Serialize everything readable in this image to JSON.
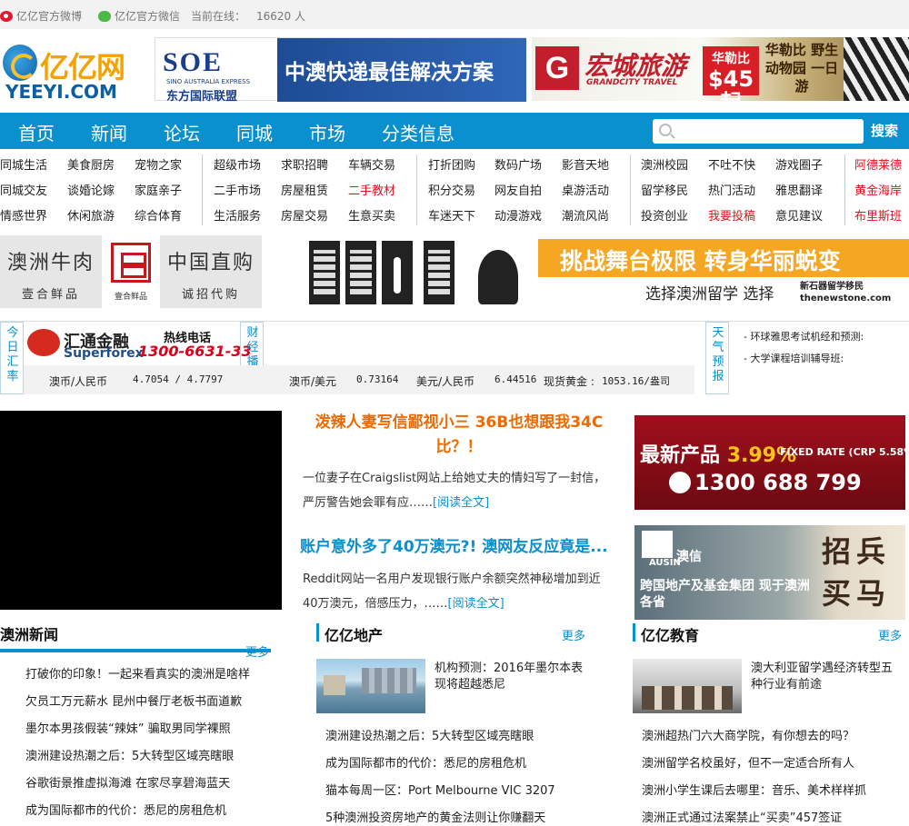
{
  "topbar": {
    "weibo": "亿亿官方微博",
    "wechat": "亿亿官方微信",
    "online_label": "当前在线：",
    "online_count": "16620 人"
  },
  "logo": {
    "cn": "亿亿网",
    "en": "YEEYI.COM"
  },
  "ads": {
    "soe": {
      "logo": "SOE",
      "sub": "SINO AUSTRALIA EXPRESS",
      "cn": "东方国际联盟",
      "slogan": "中澳快递最佳解决方案"
    },
    "grand": {
      "logo": "G",
      "cn": "宏城旅游",
      "en": "GRANDCITY TRAVEL",
      "price_top": "华勒比",
      "price": "$45起",
      "zoo": "华勒比 野生动物园 一日游"
    },
    "beef1": {
      "title": "澳洲牛肉",
      "sub": "壹合鲜品"
    },
    "beef_logo": "壹合鲜品",
    "beef2": {
      "title": "中国直购",
      "sub": "诚招代购"
    },
    "stage": {
      "headline": "挑战舞台极限 转身华丽蜕变",
      "choose": "选择澳洲留学 选择",
      "stone": "新石器留学移民 thenewstone.com"
    },
    "right1": {
      "line1": "最新产品",
      "rate": "3.99%",
      "fixed": "FIXED RATE (CRP 5.58%)",
      "phone": "1300 688 799"
    },
    "right2": {
      "brand": "AUSIN",
      "brand_cn": "澳信",
      "line": "跨国地产及基金集团 现于澳洲各省",
      "recruit": "招兵 买马"
    }
  },
  "nav": {
    "items": [
      "首页",
      "新闻",
      "论坛",
      "同城",
      "市场",
      "分类信息"
    ],
    "search_placeholder": "",
    "search_button": "搜索"
  },
  "subnav": {
    "col1": [
      [
        "同城生活",
        "美食厨房",
        "宠物之家"
      ],
      [
        "同城交友",
        "谈婚论嫁",
        "家庭亲子"
      ],
      [
        "情感世界",
        "休闲旅游",
        "综合体育"
      ]
    ],
    "col2": [
      [
        "超级市场",
        "求职招聘",
        "车辆交易"
      ],
      [
        "二手市场",
        "房屋租赁",
        "二手教材"
      ],
      [
        "生活服务",
        "房屋交易",
        "生意买卖"
      ]
    ],
    "col3": [
      [
        "打折团购",
        "数码广场",
        "影音天地"
      ],
      [
        "积分交易",
        "网友自拍",
        "桌游活动"
      ],
      [
        "车迷天下",
        "动漫游戏",
        "潮流风尚"
      ]
    ],
    "col4": [
      [
        "澳洲校园",
        "不吐不快",
        "游戏圈子"
      ],
      [
        "留学移民",
        "热门活动",
        "雅思翻译"
      ],
      [
        "投资创业",
        "我要投稿",
        "意见建议"
      ]
    ],
    "col5": [
      "阿德莱德",
      "黄金海岸",
      "布里斯班"
    ]
  },
  "finance": {
    "label_rate": "今日汇率",
    "label_fin": "财经播报",
    "label_weather": "天气预报",
    "broker_cn": "汇通金融",
    "broker_en": "Superforex",
    "hotline_label": "热线电话",
    "hotline": "1300-6631-33",
    "aud_cny_label": "澳币/人民币",
    "aud_cny": "4.7054 / 4.7797",
    "aud_usd_label": "澳币/美元",
    "aud_usd": "0.73164",
    "usd_cny_label": "美元/人民币",
    "usd_cny": "6.44516",
    "gold_label": "现货黄金 :",
    "gold": "1053.16/盎司",
    "weather": [
      "环球雅思考试机经和预测:",
      "大学课程培训辅导班:"
    ]
  },
  "lead": [
    {
      "title": "泼辣人妻写信鄙视小三 36B也想跟我34C比？！",
      "body": "一位妻子在Craigslist网站上给她丈夫的情妇写了一封信，严厉警告她会罪有应……",
      "more": "[阅读全文]"
    },
    {
      "title": "账户意外多了40万澳元?! 澳网友反应竟是...",
      "body": "Reddit网站一名用户发现银行账户余额突然神秘增加到近40万澳元，倍感压力，……",
      "more": "[阅读全文]"
    }
  ],
  "sections": {
    "news": {
      "title": "澳洲新闻",
      "more": "更多",
      "items": [
        "打破你的印象！一起来看真实的澳洲是啥样",
        "欠员工万元薪水 昆州中餐厅老板书面道歉",
        "墨尔本男孩假装“辣妹” 骗取男同学裸照",
        "澳洲建设热潮之后：5大转型区域亮瞎眼",
        "谷歌街景推虚拟海滩 在家尽享碧海蓝天",
        "成为国际都市的代价：悉尼的房租危机"
      ]
    },
    "property": {
      "title": "亿亿地产",
      "more": "更多",
      "feature": "机构预测：2016年墨尔本表现将超越悉尼",
      "items": [
        "澳洲建设热潮之后：5大转型区域亮瞎眼",
        "成为国际都市的代价：悉尼的房租危机",
        "猫本每周一区：Port Melbourne VIC 3207",
        "5种澳洲投资房地产的黄金法则让你赚翻天"
      ]
    },
    "edu": {
      "title": "亿亿教育",
      "more": "更多",
      "feature": "澳大利亚留学遇经济转型五种行业有前途",
      "items": [
        "澳洲超热门六大商学院，有你想去的吗？",
        "澳洲留学名校虽好，但不一定适合所有人",
        "澳洲小学生课后去哪里：音乐、美术样样抓",
        "澳洲正式通过法案禁止“买卖”457签证"
      ]
    }
  },
  "colors": {
    "brand_blue": "#0a8fcf",
    "accent_orange": "#ee6a00",
    "red": "#e0121f"
  }
}
